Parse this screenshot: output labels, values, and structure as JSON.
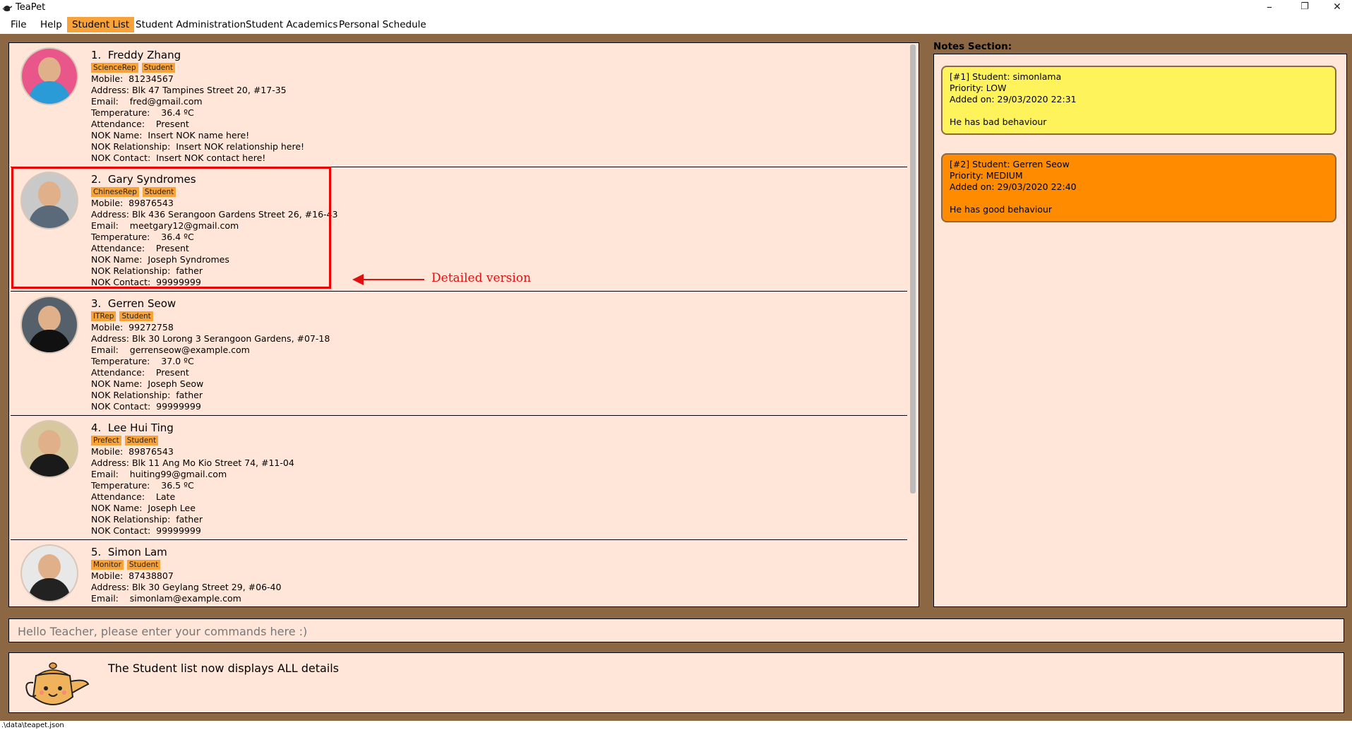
{
  "window": {
    "title": "TeaPet",
    "minimize": "–",
    "restore": "❐",
    "close": "✕"
  },
  "menu": [
    {
      "label": "File"
    },
    {
      "label": "Help"
    },
    {
      "label": "Student List",
      "active": true
    },
    {
      "label": "Student Administration"
    },
    {
      "label": "Student Academics"
    },
    {
      "label": "Personal Schedule"
    }
  ],
  "students": [
    {
      "index": "1.",
      "name": "Freddy Zhang",
      "tags": [
        "ScienceRep",
        "Student"
      ],
      "mobile": "Mobile:  81234567",
      "address": "Address: Blk 47 Tampines Street 20, #17-35",
      "email": "Email:    fred@gmail.com",
      "temperature": "Temperature:    36.4 ºC",
      "attendance": "Attendance:    Present",
      "nok_name": "NOK Name:  Insert NOK name here!",
      "nok_relationship": "NOK Relationship:  Insert NOK relationship here!",
      "nok_contact": "NOK Contact:  Insert NOK contact here!"
    },
    {
      "index": "2.",
      "name": "Gary Syndromes",
      "tags": [
        "ChineseRep",
        "Student"
      ],
      "mobile": "Mobile:  89876543",
      "address": "Address: Blk 436 Serangoon Gardens Street 26, #16-43",
      "email": "Email:    meetgary12@gmail.com",
      "temperature": "Temperature:    36.4 ºC",
      "attendance": "Attendance:    Present",
      "nok_name": "NOK Name:  Joseph Syndromes",
      "nok_relationship": "NOK Relationship:  father",
      "nok_contact": "NOK Contact:  99999999"
    },
    {
      "index": "3.",
      "name": "Gerren Seow",
      "tags": [
        "ITRep",
        "Student"
      ],
      "mobile": "Mobile:  99272758",
      "address": "Address: Blk 30 Lorong 3 Serangoon Gardens, #07-18",
      "email": "Email:    gerrenseow@example.com",
      "temperature": "Temperature:    37.0 ºC",
      "attendance": "Attendance:    Present",
      "nok_name": "NOK Name:  Joseph Seow",
      "nok_relationship": "NOK Relationship:  father",
      "nok_contact": "NOK Contact:  99999999"
    },
    {
      "index": "4.",
      "name": "Lee Hui Ting",
      "tags": [
        "Prefect",
        "Student"
      ],
      "mobile": "Mobile:  89876543",
      "address": "Address: Blk 11 Ang Mo Kio Street 74, #11-04",
      "email": "Email:    huiting99@gmail.com",
      "temperature": "Temperature:    36.5 ºC",
      "attendance": "Attendance:    Late",
      "nok_name": "NOK Name:  Joseph Lee",
      "nok_relationship": "NOK Relationship:  father",
      "nok_contact": "NOK Contact:  99999999"
    },
    {
      "index": "5.",
      "name": "Simon Lam",
      "tags": [
        "Monitor",
        "Student"
      ],
      "mobile": "Mobile:  87438807",
      "address": "Address: Blk 30 Geylang Street 29, #06-40",
      "email": "Email:    simonlam@example.com",
      "temperature": "",
      "attendance": "",
      "nok_name": "",
      "nok_relationship": "",
      "nok_contact": ""
    }
  ],
  "annotation": {
    "label": "Detailed version"
  },
  "notes": {
    "title": "Notes Section:",
    "items": [
      {
        "header": "[#1] Student: simonlama",
        "priority": "Priority: LOW",
        "added": "Added on: 29/03/2020 22:31",
        "text": "He has bad behaviour",
        "color": "#fff35c"
      },
      {
        "header": "[#2] Student: Gerren Seow",
        "priority": "Priority: MEDIUM",
        "added": "Added on: 29/03/2020 22:40",
        "text": "He has good behaviour",
        "color": "#ff8c00"
      }
    ]
  },
  "command": {
    "placeholder": "Hello Teacher, please enter your commands here :)",
    "value": ""
  },
  "result": {
    "message": "The Student list now displays ALL details"
  },
  "status": {
    "path": ".\\data\\teapet.json"
  },
  "colors": {
    "frame": "#8b6843",
    "panel": "#ffe6d8",
    "tag": "#f7a33a",
    "accent": "#e01010"
  }
}
